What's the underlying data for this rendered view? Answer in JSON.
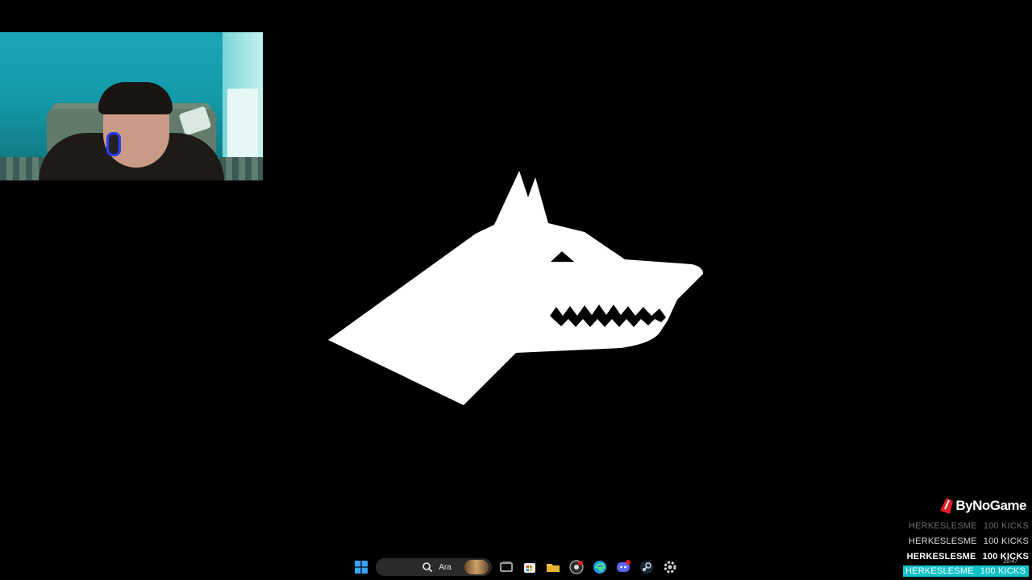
{
  "taskbar": {
    "search_placeholder": "Ara",
    "icons": [
      "windows-start-icon",
      "search-icon",
      "task-view-icon",
      "store-icon",
      "file-explorer-icon",
      "chrome-icon",
      "edge-icon",
      "discord-icon",
      "steam-icon",
      "settings-icon"
    ]
  },
  "overlay": {
    "brand": "ByNoGame",
    "kicks": [
      {
        "name": "HERKESLESME",
        "amount": "100 KICKS"
      },
      {
        "name": "HERKESLESME",
        "amount": "100 KICKS"
      },
      {
        "name": "HERKESLESME",
        "amount": "100 KICKS"
      },
      {
        "name": "HERKESLESME",
        "amount": "100 KICKS"
      }
    ],
    "highlight_color": "#0fc3c9"
  },
  "clock": "20:47"
}
